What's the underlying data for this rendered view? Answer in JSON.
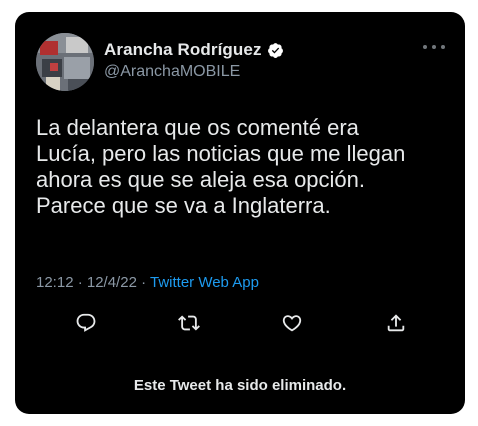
{
  "tweet": {
    "author_name": "Arancha Rodríguez",
    "author_handle": "@AranchaMOBILE",
    "verified": true,
    "text": "La delantera que os comenté era\nLucía, pero las noticias que me llegan\nahora es que se aleja esa opción.\nParece que se va a Inglaterra.",
    "time": "12:12 · 12/4/22 · ",
    "source": "Twitter Web App",
    "actions": [
      "reply-icon",
      "retweet-icon",
      "like-icon",
      "share-icon"
    ],
    "more_icon": "more-horizontal-icon",
    "deleted_notice": "Este Tweet ha sido eliminado."
  },
  "colors": {
    "card_background": "#000000",
    "primary_text": "#e7e9ea",
    "secondary_text": "#8b98a5",
    "link": "#1d9bf0",
    "verified_badge": "#ffffff"
  }
}
